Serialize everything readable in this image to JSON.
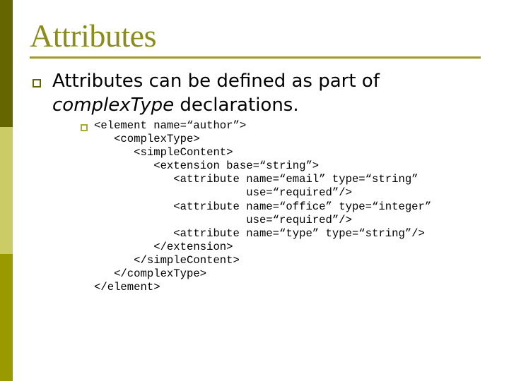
{
  "slide": {
    "title": "Attributes",
    "bullets": [
      {
        "text_before": "Attributes can be defined as part of",
        "emphasis": "complexType",
        "text_after": " declarations.",
        "icon": "hollow-square-bullet",
        "sub_bullets": [
          {
            "icon": "hollow-square-bullet",
            "code_lines": [
              "<element name=“author”>",
              "   <complexType>",
              "      <simpleContent>",
              "         <extension base=“string”>",
              "            <attribute name=“email” type=“string”",
              "                       use=“required”/>",
              "            <attribute name=“office” type=“integer”",
              "                       use=“required”/>",
              "            <attribute name=“type” type=“string”/>",
              "         </extension>",
              "      </simpleContent>",
              "   </complexType>",
              "</element>"
            ]
          }
        ]
      }
    ]
  },
  "colors": {
    "title": "#8c8c1e",
    "rule": "#a09a2c",
    "bar_top": "#666600",
    "bar_middle": "#cccc66",
    "bar_bottom": "#999900",
    "bullet_main": "#666600",
    "bullet_sub": "#a8a83c"
  }
}
